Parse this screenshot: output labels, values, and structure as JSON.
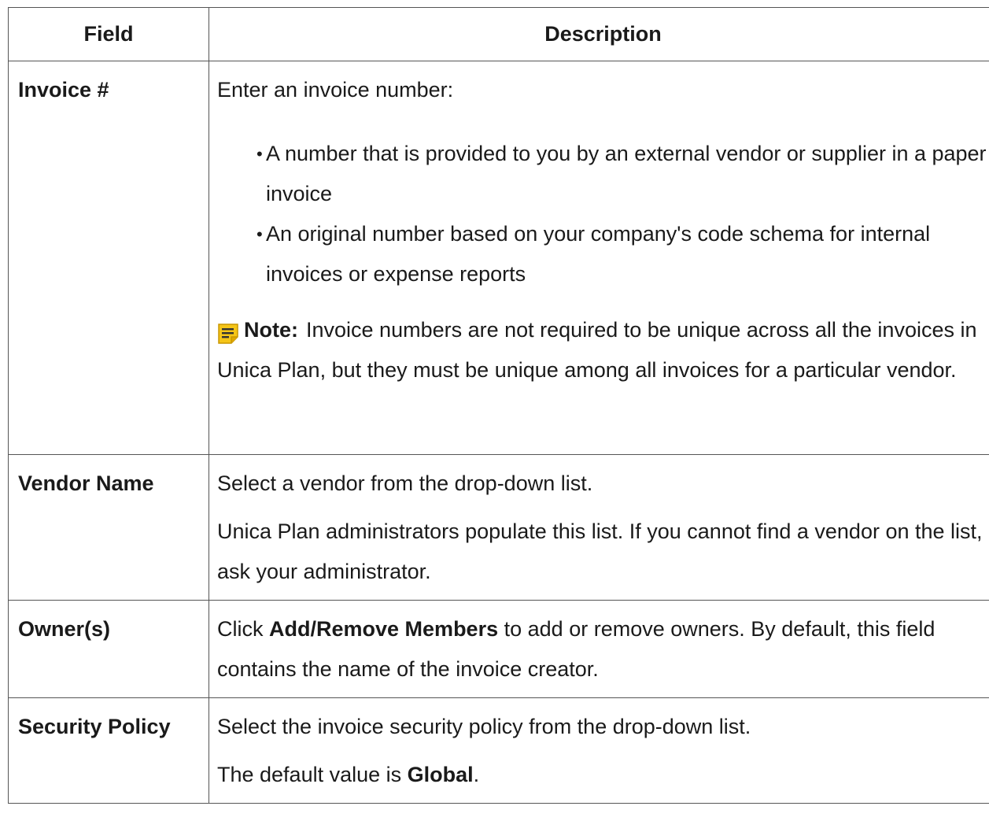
{
  "table": {
    "headers": {
      "field": "Field",
      "description": "Description"
    },
    "rows": {
      "invoice": {
        "field": "Invoice #",
        "intro": "Enter an invoice number:",
        "bullets": [
          "A number that is provided to you by an external vendor or supplier in a paper invoice",
          "An original number based on your company's code schema for internal invoices or expense reports"
        ],
        "note_label": "Note:",
        "note_text": "Invoice numbers are not required to be unique across all the invoices in Unica Plan, but they must be unique among all invoices for a particular vendor.",
        "note_icon": "note-icon",
        "note_icon_color": "#f5c518"
      },
      "vendor": {
        "field": "Vendor Name",
        "p1": "Select a vendor from the drop-down list.",
        "p2": "Unica Plan administrators populate this list. If you cannot find a vendor on the list, ask your administrator."
      },
      "owners": {
        "field": "Owner(s)",
        "pre": "Click",
        "bold": "Add/Remove Members",
        "post": "to add or remove owners. By default, this field contains the name of the invoice creator."
      },
      "security": {
        "field": "Security Policy",
        "p1": "Select the invoice security policy from the drop-down list.",
        "p2_pre": "The default value is",
        "p2_bold": "Global",
        "p2_post": "."
      }
    }
  }
}
